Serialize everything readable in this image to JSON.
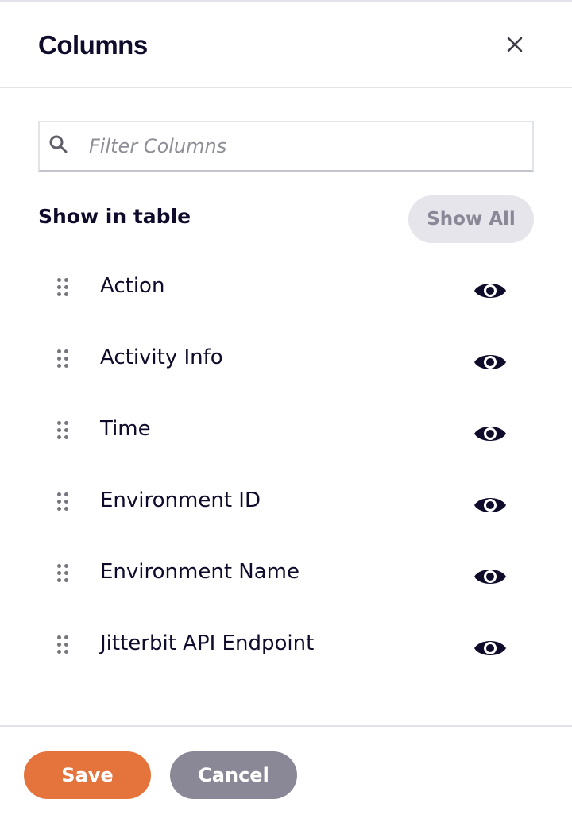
{
  "header": {
    "title": "Columns",
    "close_icon": "close-icon"
  },
  "search": {
    "icon": "search-icon",
    "placeholder": "Filter Columns",
    "value": ""
  },
  "section": {
    "label": "Show in table",
    "show_all_label": "Show All"
  },
  "columns": [
    {
      "label": "Action",
      "visible": true
    },
    {
      "label": "Activity Info",
      "visible": true
    },
    {
      "label": "Time",
      "visible": true
    },
    {
      "label": "Environment ID",
      "visible": true
    },
    {
      "label": "Environment Name",
      "visible": true
    },
    {
      "label": "Jitterbit API Endpoint",
      "visible": true
    }
  ],
  "footer": {
    "save_label": "Save",
    "cancel_label": "Cancel"
  },
  "colors": {
    "primary": "#e5743c",
    "secondary": "#8a8896",
    "text": "#0e0b2b"
  }
}
